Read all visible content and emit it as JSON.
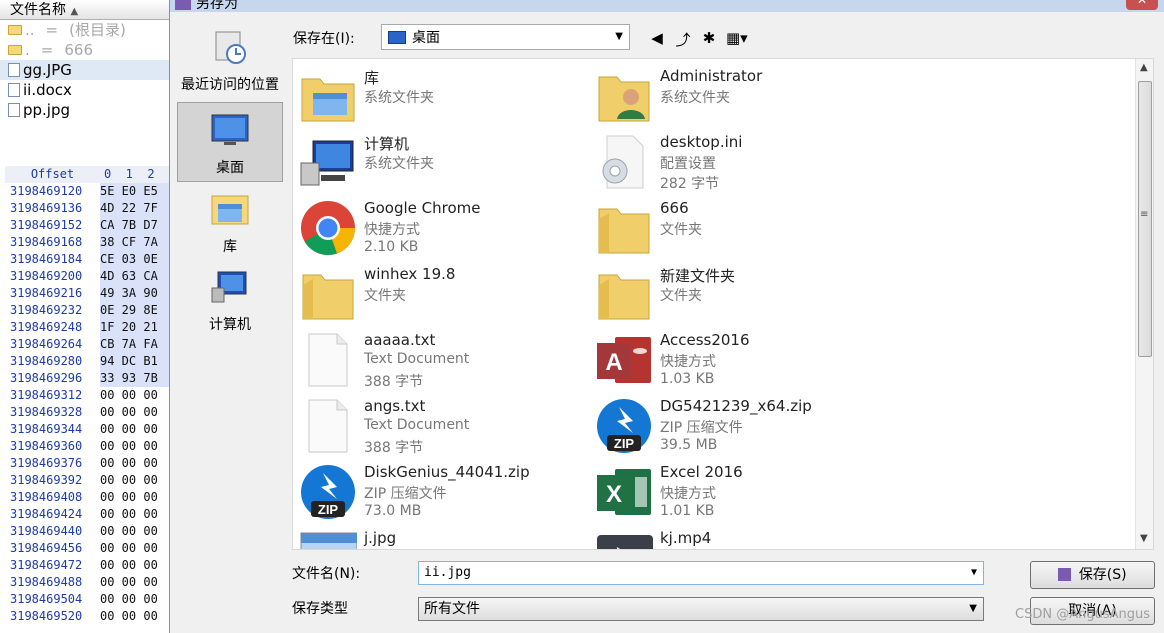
{
  "left_panel": {
    "header": "文件名称",
    "rows": [
      {
        "name": "..",
        "eq": "=",
        "note": "(根目录)",
        "type": "folder",
        "dim": true
      },
      {
        "name": ".",
        "eq": "=",
        "note": "666",
        "type": "folder",
        "dim": true
      },
      {
        "name": "gg.JPG",
        "type": "file",
        "selected": true
      },
      {
        "name": "ii.docx",
        "type": "file"
      },
      {
        "name": "pp.jpg",
        "type": "file"
      }
    ],
    "hex": {
      "header_offset": "Offset",
      "header_cols": "0  1  2",
      "rows": [
        {
          "offset": "3198469120",
          "bytes": "5E E0 E5",
          "hi": true
        },
        {
          "offset": "3198469136",
          "bytes": "4D 22 7F",
          "hi": true
        },
        {
          "offset": "3198469152",
          "bytes": "CA 7B D7",
          "hi": true
        },
        {
          "offset": "3198469168",
          "bytes": "38 CF 7A",
          "hi": true
        },
        {
          "offset": "3198469184",
          "bytes": "CE 03 0E",
          "hi": true
        },
        {
          "offset": "3198469200",
          "bytes": "4D 63 CA",
          "hi": true
        },
        {
          "offset": "3198469216",
          "bytes": "49 3A 90",
          "hi": true
        },
        {
          "offset": "3198469232",
          "bytes": "0E 29 8E",
          "hi": true
        },
        {
          "offset": "3198469248",
          "bytes": "1F 20 21",
          "hi": true
        },
        {
          "offset": "3198469264",
          "bytes": "CB 7A FA",
          "hi": true
        },
        {
          "offset": "3198469280",
          "bytes": "94 DC B1",
          "hi": true
        },
        {
          "offset": "3198469296",
          "bytes": "33 93 7B",
          "hi": true
        },
        {
          "offset": "3198469312",
          "bytes": "00 00 00",
          "hi": false
        },
        {
          "offset": "3198469328",
          "bytes": "00 00 00",
          "hi": false
        },
        {
          "offset": "3198469344",
          "bytes": "00 00 00",
          "hi": false
        },
        {
          "offset": "3198469360",
          "bytes": "00 00 00",
          "hi": false
        },
        {
          "offset": "3198469376",
          "bytes": "00 00 00",
          "hi": false
        },
        {
          "offset": "3198469392",
          "bytes": "00 00 00",
          "hi": false
        },
        {
          "offset": "3198469408",
          "bytes": "00 00 00",
          "hi": false
        },
        {
          "offset": "3198469424",
          "bytes": "00 00 00",
          "hi": false
        },
        {
          "offset": "3198469440",
          "bytes": "00 00 00",
          "hi": false
        },
        {
          "offset": "3198469456",
          "bytes": "00 00 00",
          "hi": false
        },
        {
          "offset": "3198469472",
          "bytes": "00 00 00",
          "hi": false
        },
        {
          "offset": "3198469488",
          "bytes": "00 00 00",
          "hi": false
        },
        {
          "offset": "3198469504",
          "bytes": "00 00 00",
          "hi": false
        },
        {
          "offset": "3198469520",
          "bytes": "00 00 00",
          "hi": false
        }
      ]
    }
  },
  "dialog": {
    "title": "另存为",
    "close_label": "✕",
    "places": [
      {
        "label": "最近访问的位置",
        "icon": "recent-places-icon",
        "selected": false
      },
      {
        "label": "桌面",
        "icon": "desktop-icon",
        "selected": true
      },
      {
        "label": "库",
        "icon": "library-icon",
        "selected": false
      },
      {
        "label": "计算机",
        "icon": "computer-icon",
        "selected": false
      }
    ],
    "save_in_label": "保存在(I):",
    "save_in_value": "桌面",
    "files_left": [
      {
        "name": "库",
        "line1": "系统文件夹",
        "line2": "",
        "icon": "library-folder-icon"
      },
      {
        "name": "计算机",
        "line1": "系统文件夹",
        "line2": "",
        "icon": "computer-icon"
      },
      {
        "name": "Google Chrome",
        "line1": "快捷方式",
        "line2": "2.10 KB",
        "icon": "chrome-icon"
      },
      {
        "name": "winhex 19.8",
        "line1": "文件夹",
        "line2": "",
        "icon": "folder-icon"
      },
      {
        "name": "aaaaa.txt",
        "line1": "Text Document",
        "line2": "388 字节",
        "icon": "text-file-icon"
      },
      {
        "name": "angs.txt",
        "line1": "Text Document",
        "line2": "388 字节",
        "icon": "text-file-icon"
      },
      {
        "name": "DiskGenius_44041.zip",
        "line1": "ZIP 压缩文件",
        "line2": "73.0 MB",
        "icon": "zip-icon"
      },
      {
        "name": "j.jpg",
        "line1": "",
        "line2": "",
        "icon": "image-file-icon"
      }
    ],
    "files_right": [
      {
        "name": "Administrator",
        "line1": "系统文件夹",
        "line2": "",
        "icon": "user-folder-icon"
      },
      {
        "name": "desktop.ini",
        "line1": "配置设置",
        "line2": "282 字节",
        "icon": "settings-file-icon"
      },
      {
        "name": "666",
        "line1": "文件夹",
        "line2": "",
        "icon": "folder-icon"
      },
      {
        "name": "新建文件夹",
        "line1": "文件夹",
        "line2": "",
        "icon": "folder-icon"
      },
      {
        "name": "Access2016",
        "line1": "快捷方式",
        "line2": "1.03 KB",
        "icon": "access-icon"
      },
      {
        "name": "DG5421239_x64.zip",
        "line1": "ZIP 压缩文件",
        "line2": "39.5 MB",
        "icon": "zip-icon"
      },
      {
        "name": "Excel 2016",
        "line1": "快捷方式",
        "line2": "1.01 KB",
        "icon": "excel-icon"
      },
      {
        "name": "kj.mp4",
        "line1": "",
        "line2": "",
        "icon": "video-file-icon"
      }
    ],
    "filename_label": "文件名(N):",
    "filename_value": "ii.jpg",
    "filetype_label": "保存类型",
    "filetype_value": "所有文件",
    "save_button": "保存(S)",
    "cancel_button": "取消(A)",
    "watermark": "CSDN @AngusAngus",
    "colors": {
      "accent": "#7eb4ea",
      "selected_place": "#d4d4d4",
      "folder": "#f5d87b"
    }
  }
}
